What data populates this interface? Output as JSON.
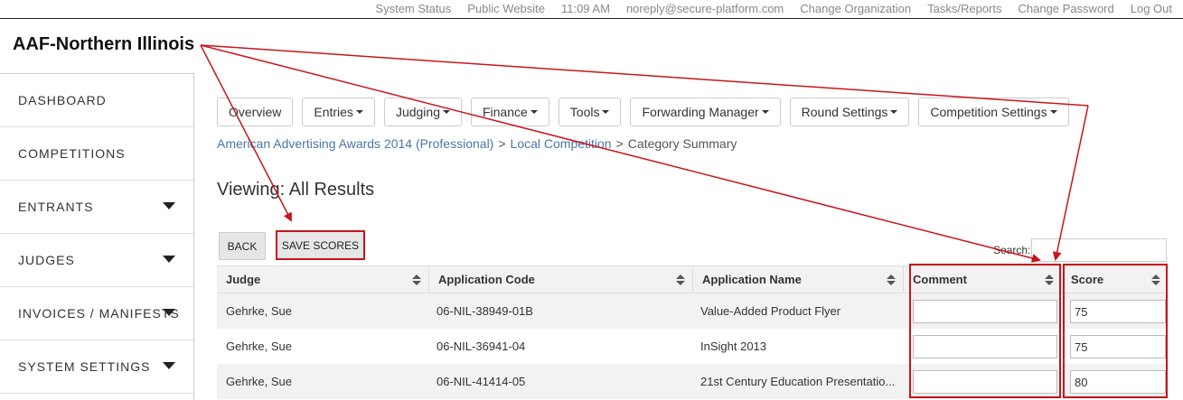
{
  "topbar": {
    "system_status": "System Status",
    "public_website": "Public Website",
    "time": "11:09 AM",
    "email": "noreply@secure-platform.com",
    "change_org": "Change Organization",
    "tasks_reports": "Tasks/Reports",
    "change_password": "Change Password",
    "log_out": "Log Out"
  },
  "org_title": "AAF-Northern Illinois",
  "sidebar": {
    "items": [
      {
        "label": "DASHBOARD"
      },
      {
        "label": "COMPETITIONS"
      },
      {
        "label": "ENTRANTS"
      },
      {
        "label": "JUDGES"
      },
      {
        "label": "INVOICES / MANIFESTS"
      },
      {
        "label": "SYSTEM SETTINGS"
      }
    ]
  },
  "toolbar": {
    "overview": "Overview",
    "entries": "Entries",
    "judging": "Judging",
    "finance": "Finance",
    "tools": "Tools",
    "forwarding_manager": "Forwarding Manager",
    "round_settings": "Round Settings",
    "competition_settings": "Competition Settings"
  },
  "breadcrumb": {
    "program": "American Advertising Awards 2014 (Professional)",
    "competition": "Local Competition",
    "current": "Category Summary",
    "separator": ">"
  },
  "viewing": "Viewing: All Results",
  "buttons": {
    "back": "BACK",
    "save_scores": "SAVE SCORES"
  },
  "search": {
    "label": "Search:",
    "value": ""
  },
  "table": {
    "headers": {
      "judge": "Judge",
      "application_code": "Application Code",
      "application_name": "Application Name",
      "comment": "Comment",
      "score": "Score"
    },
    "rows": [
      {
        "judge": "Gehrke, Sue",
        "code": "06-NIL-38949-01B",
        "name": "Value-Added Product Flyer",
        "comment": "",
        "score": "75"
      },
      {
        "judge": "Gehrke, Sue",
        "code": "06-NIL-36941-04",
        "name": "InSight 2013",
        "comment": "",
        "score": "75"
      },
      {
        "judge": "Gehrke, Sue",
        "code": "06-NIL-41414-05",
        "name": "21st Century Education Presentatio...",
        "comment": "",
        "score": "80"
      }
    ]
  },
  "annotation_color": "#c8151b"
}
